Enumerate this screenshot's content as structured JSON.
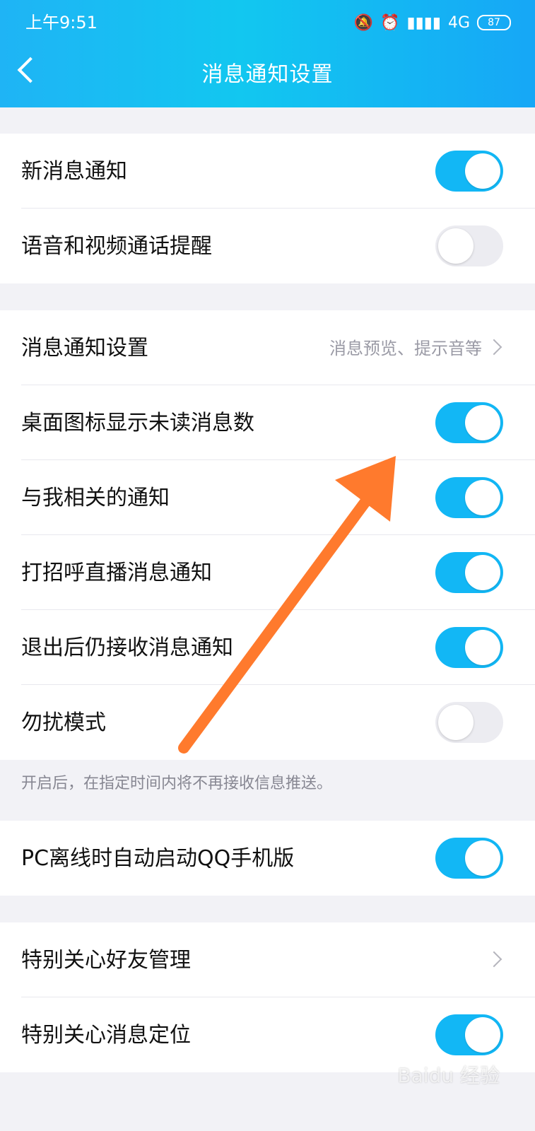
{
  "status_bar": {
    "time": "上午9:51",
    "network": "4G",
    "battery": "87"
  },
  "header": {
    "title": "消息通知设置"
  },
  "groups": [
    {
      "rows": [
        {
          "label": "新消息通知",
          "toggle": "on"
        },
        {
          "label": "语音和视频通话提醒",
          "toggle": "off"
        }
      ]
    },
    {
      "rows": [
        {
          "label": "消息通知设置",
          "sub": "消息预览、提示音等",
          "chevron": true
        },
        {
          "label": "桌面图标显示未读消息数",
          "toggle": "on"
        },
        {
          "label": "与我相关的通知",
          "toggle": "on"
        },
        {
          "label": "打招呼直播消息通知",
          "toggle": "on"
        },
        {
          "label": "退出后仍接收消息通知",
          "toggle": "on"
        },
        {
          "label": "勿扰模式",
          "toggle": "off"
        }
      ],
      "note": "开启后，在指定时间内将不再接收信息推送。"
    },
    {
      "rows": [
        {
          "label": "PC离线时自动启动QQ手机版",
          "toggle": "on"
        }
      ]
    },
    {
      "rows": [
        {
          "label": "特别关心好友管理",
          "chevron": true
        },
        {
          "label": "特别关心消息定位",
          "toggle": "on"
        }
      ]
    }
  ],
  "colors": {
    "accent": "#12b7f5",
    "arrow": "#ff7a2d"
  },
  "watermark": "Baidu 经验"
}
